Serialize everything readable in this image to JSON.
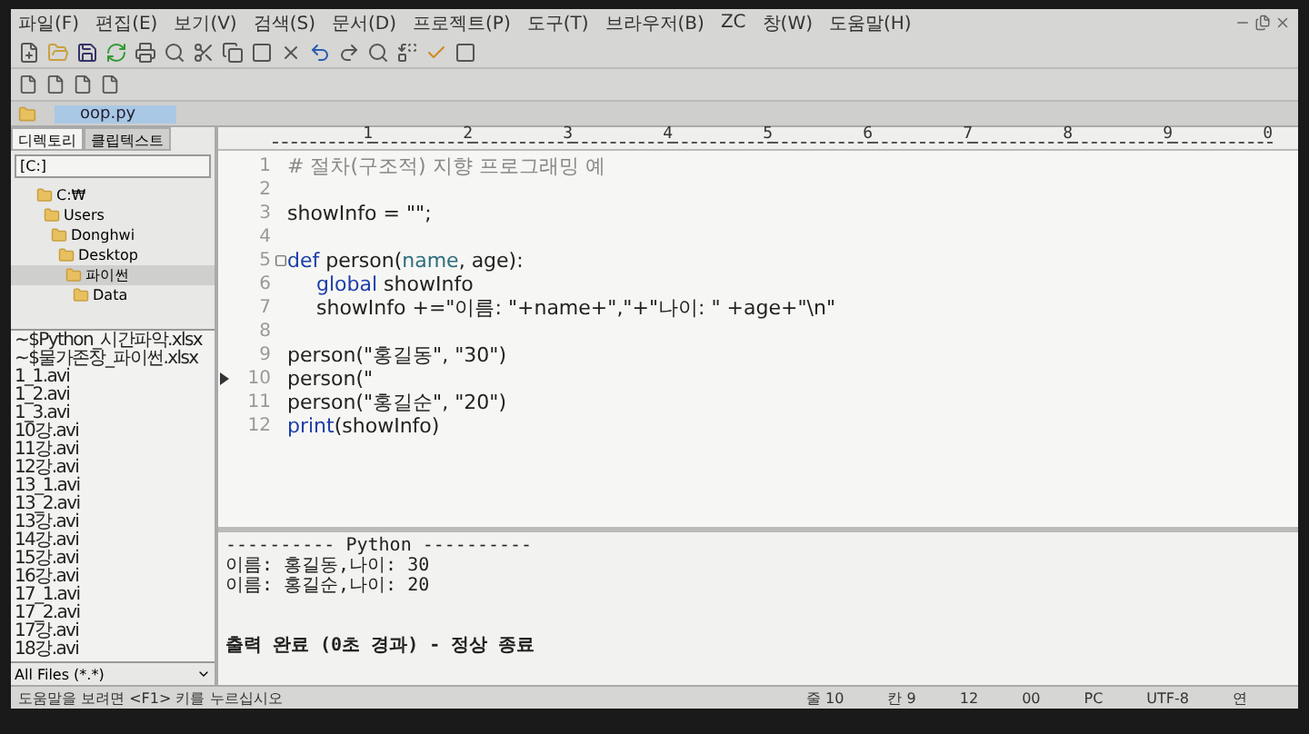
{
  "menu": [
    "파일(F)",
    "편집(E)",
    "보기(V)",
    "검색(S)",
    "문서(D)",
    "프로젝트(P)",
    "도구(T)",
    "브라우저(B)",
    "ZC",
    "창(W)",
    "도움말(H)"
  ],
  "document_tabs": [
    {
      "label": "oop.py",
      "selected": true
    }
  ],
  "sidebar": {
    "tabs": [
      {
        "label": "디렉토리",
        "selected": true
      },
      {
        "label": "클립텍스트",
        "selected": false
      }
    ],
    "drive": "[C:]",
    "tree": [
      {
        "label": "C:₩",
        "selected": false,
        "children": [
          {
            "label": "Users",
            "selected": false,
            "children": [
              {
                "label": "Donghwi",
                "selected": false,
                "children": [
                  {
                    "label": "Desktop",
                    "selected": false,
                    "children": [
                      {
                        "label": "파이썬",
                        "selected": true,
                        "children": [
                          {
                            "label": "Data",
                            "selected": false
                          }
                        ]
                      }
                    ]
                  }
                ]
              }
            ]
          }
        ]
      }
    ],
    "files": [
      "~$Python_시간파악.xlsx",
      "~$물가존장_파이썬.xlsx",
      "1_1.avi",
      "1_2.avi",
      "1_3.avi",
      "10강.avi",
      "11강.avi",
      "12강.avi",
      "13_1.avi",
      "13_2.avi",
      "13강.avi",
      "14강.avi",
      "15강.avi",
      "16강.avi",
      "17_1.avi",
      "17_2.avi",
      "17강.avi",
      "18강.avi"
    ],
    "filter": "All Files (*.*)"
  },
  "ruler": [
    "1",
    "2",
    "3",
    "4",
    "5",
    "6",
    "7",
    "8",
    "9",
    "0"
  ],
  "code": [
    {
      "number": "1",
      "fold": false,
      "current": false,
      "tokens": [
        {
          "text": "# 절차(구조적) 지향 프로그래밍 예",
          "kind": "comment"
        }
      ]
    },
    {
      "number": "2",
      "fold": false,
      "current": false
    },
    {
      "number": "3",
      "fold": false,
      "current": false,
      "tokens": [
        {
          "text": "showInfo = \"\";",
          "kind": "plain"
        }
      ]
    },
    {
      "number": "4",
      "fold": false,
      "current": false
    },
    {
      "number": "5",
      "fold": true,
      "current": false,
      "tokens": [
        {
          "text": "def",
          "kind": "keyword"
        },
        {
          "text": " person(",
          "kind": "plain"
        },
        {
          "text": "name",
          "kind": "param"
        },
        {
          "text": ", age):",
          "kind": "plain"
        }
      ],
      "children": [
        {
          "number": "6",
          "fold": false,
          "current": false,
          "tokens": [
            {
              "text": "global",
              "kind": "keyword"
            },
            {
              "text": " showInfo",
              "kind": "plain"
            }
          ]
        },
        {
          "number": "7",
          "fold": false,
          "current": false,
          "tokens": [
            {
              "text": "showInfo +=\"이름: \"+name+\",\"+\"나이: \" +age+\"\\n\"",
              "kind": "plain"
            }
          ]
        }
      ]
    },
    {
      "number": "8",
      "fold": false,
      "current": false
    },
    {
      "number": "9",
      "fold": false,
      "current": false,
      "tokens": [
        {
          "text": "person(\"홍길동\", \"30\")",
          "kind": "plain"
        }
      ]
    },
    {
      "number": "10",
      "fold": false,
      "current": true,
      "tokens": [
        {
          "text": "person(\"",
          "kind": "plain"
        }
      ]
    },
    {
      "number": "11",
      "fold": false,
      "current": false,
      "tokens": [
        {
          "text": "person(\"홍길순\", \"20\")",
          "kind": "plain"
        }
      ]
    },
    {
      "number": "12",
      "fold": false,
      "current": false,
      "tokens": [
        {
          "text": "print",
          "kind": "keyword"
        },
        {
          "text": "(showInfo)",
          "kind": "plain"
        }
      ]
    }
  ],
  "output": [
    {
      "text": "---------- Python ----------",
      "kind": "header"
    },
    {
      "text": "이름: 홍길동,나이: 30",
      "kind": "line"
    },
    {
      "text": "이름: 홍길순,나이: 20",
      "kind": "line"
    },
    {
      "text": "출력 완료 (0초 경과) - 정상 종료",
      "kind": "summary"
    }
  ],
  "status_bar": {
    "hint": "도움말을 보려면 <F1> 키를 누르십시오",
    "fields": [
      "줄 10",
      "칸 9",
      "12",
      "00",
      "PC",
      "UTF-8",
      "연"
    ]
  }
}
